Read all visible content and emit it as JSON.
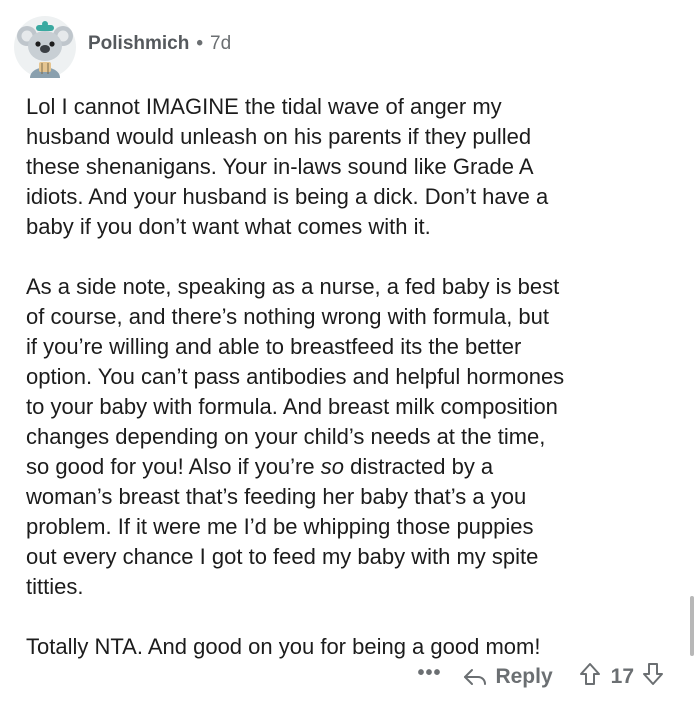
{
  "comment": {
    "author": "Polishmich",
    "separator": "•",
    "age": "7d",
    "paragraphs": [
      {
        "lines": [
          "Lol I cannot IMAGINE the tidal wave of anger my",
          "husband would unleash on his parents if they pulled",
          "these shenanigans. Your in-laws sound like Grade A",
          "idiots. And your husband is being a dick. Don’t have a",
          "baby if you don’t want what comes with it."
        ]
      },
      {
        "lines": [
          "As a side note, speaking as a nurse, a fed baby is best",
          "of course, and there’s nothing wrong with formula, but",
          "if you’re willing and able to breastfeed its the better",
          "option. You can’t pass antibodies and helpful hormones",
          "to your baby with formula. And breast milk composition",
          "changes depending on your child’s needs at the time,"
        ],
        "line7_pre": "so good for you! Also if you’re ",
        "line7_em": "so",
        "line7_post": " distracted by a",
        "lines_after": [
          "woman’s breast that’s feeding her baby that’s a you",
          "problem. If it were me I’d be whipping those puppies",
          "out every chance I got to feed my baby with my spite",
          "titties."
        ]
      },
      {
        "lines": [
          "Totally NTA. And good on you for being a good mom!"
        ]
      }
    ],
    "actions": {
      "more": "•••",
      "reply": "Reply",
      "score": "17"
    }
  },
  "colors": {
    "text": "#1c1c1c",
    "meta": "#6b6f72",
    "avatar_bg": "#d9dde0",
    "avatar_accent": "#3aa9a0"
  },
  "icons": {
    "avatar": "koala-snoo-avatar",
    "reply": "reply-arrow-icon",
    "upvote": "upvote-arrow-icon",
    "downvote": "downvote-arrow-icon"
  }
}
